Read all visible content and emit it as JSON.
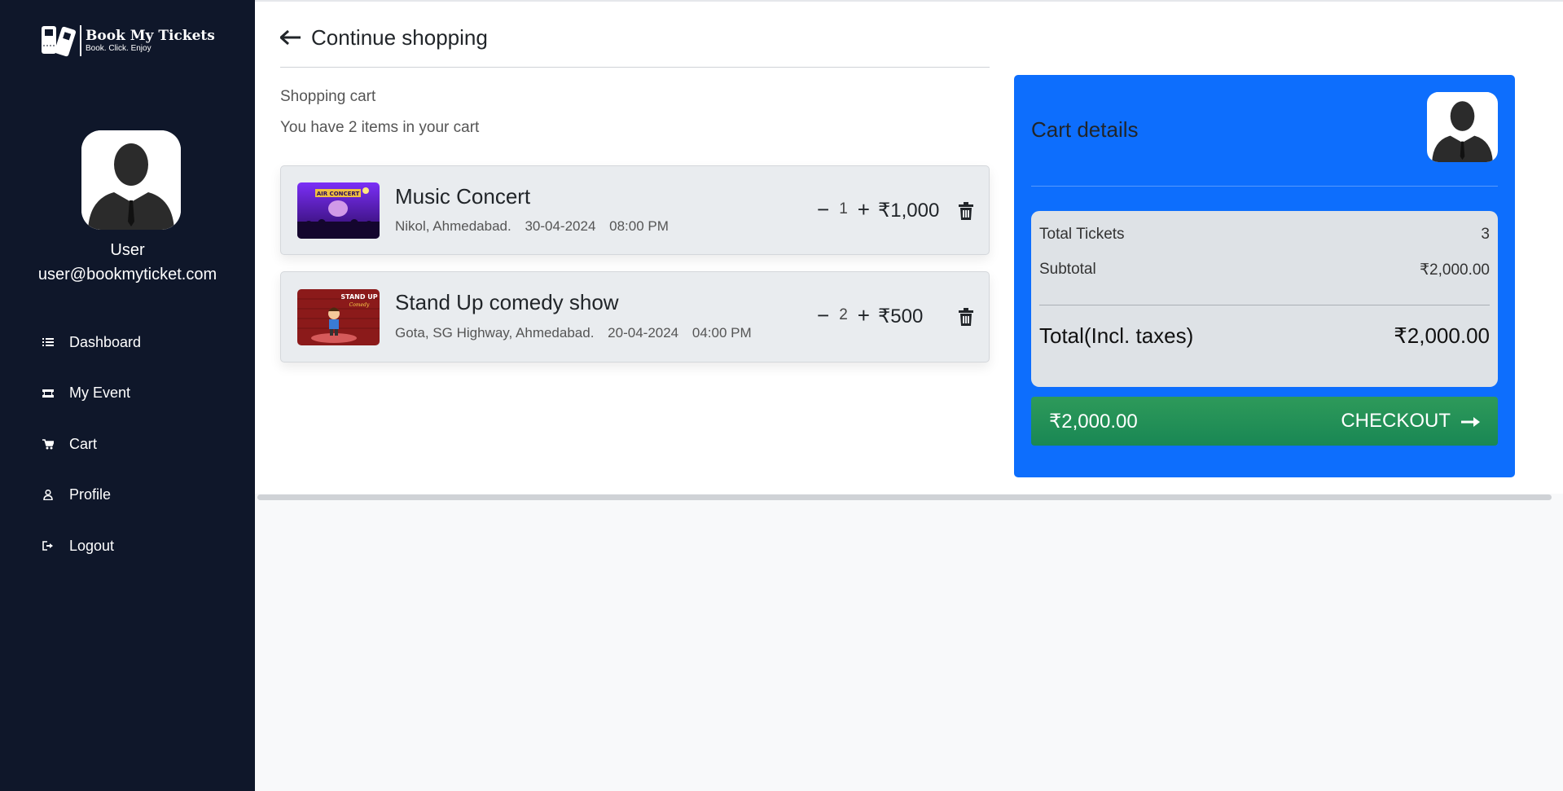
{
  "brand": {
    "name": "Book My Tickets",
    "tagline": "Book. Click. Enjoy"
  },
  "user": {
    "name": "User",
    "email": "user@bookmyticket.com"
  },
  "nav": [
    {
      "label": "Dashboard",
      "icon": "list-icon"
    },
    {
      "label": "My Event",
      "icon": "ticket-icon"
    },
    {
      "label": "Cart",
      "icon": "cart-icon"
    },
    {
      "label": "Profile",
      "icon": "person-icon"
    },
    {
      "label": "Logout",
      "icon": "logout-icon"
    }
  ],
  "main": {
    "continue_label": "Continue shopping",
    "cart_title": "Shopping cart",
    "cart_subtitle": "You have 2 items in your cart"
  },
  "items": [
    {
      "title": "Music Concert",
      "location": "Nikol, Ahmedabad.",
      "date": "30-04-2024",
      "time": "08:00 PM",
      "qty": "1",
      "price": "₹1,000",
      "thumb_text": "AIR CONCERT"
    },
    {
      "title": "Stand Up comedy show",
      "location": "Gota, SG Highway, Ahmedabad.",
      "date": "20-04-2024",
      "time": "04:00 PM",
      "qty": "2",
      "price": "₹500",
      "thumb_text": "STAND UP",
      "thumb_subtext": "Comedy"
    }
  ],
  "cart_details": {
    "title": "Cart details",
    "total_tickets_label": "Total Tickets",
    "total_tickets_value": "3",
    "subtotal_label": "Subtotal",
    "subtotal_value": "₹2,000.00",
    "total_label": "Total(Incl. taxes)",
    "total_value": "₹2,000.00",
    "checkout_amount": "₹2,000.00",
    "checkout_label": "CHECKOUT"
  },
  "colors": {
    "sidebar": "#0f172a",
    "panel": "#0d6efd",
    "checkout": "#198754"
  }
}
